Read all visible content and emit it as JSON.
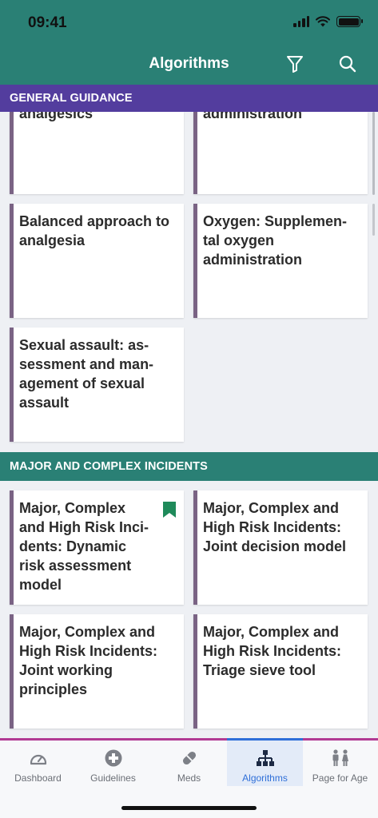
{
  "status_bar": {
    "time": "09:41"
  },
  "header": {
    "title": "Algorithms",
    "filter_icon": "filter-icon",
    "search_icon": "search-icon"
  },
  "sections": [
    {
      "title": "GENERAL GUIDANCE",
      "cards": [
        {
          "label": "analgesics",
          "truncated": true
        },
        {
          "label": "administration",
          "truncated": true
        },
        {
          "label": "Balanced approach to analgesia"
        },
        {
          "label": "Oxygen: Supplemen-tal oxygen administration"
        },
        {
          "label": "Sexual assault: as-sessment and man-agement of sexual assault"
        }
      ]
    },
    {
      "title": "MAJOR AND COMPLEX INCIDENTS",
      "cards": [
        {
          "label": "Major, Complex and High Risk Inci-dents: Dynamic risk assessment model",
          "bookmarked": true
        },
        {
          "label": "Major, Complex and High Risk Incidents: Joint decision model"
        },
        {
          "label": "Major, Complex and High Risk Incidents: Joint working principles"
        },
        {
          "label": "Major, Complex and High Risk Incidents: Triage sieve tool"
        }
      ]
    }
  ],
  "bottom_nav": [
    {
      "label": "Dashboard",
      "icon": "gauge-icon",
      "active": false
    },
    {
      "label": "Guidelines",
      "icon": "medical-cross-icon",
      "active": false
    },
    {
      "label": "Meds",
      "icon": "pill-icon",
      "active": false
    },
    {
      "label": "Algorithms",
      "icon": "flowchart-icon",
      "active": true
    },
    {
      "label": "Page for Age",
      "icon": "people-icon",
      "active": false
    }
  ],
  "colors": {
    "header_bg": "#2a8075",
    "general_section_bg": "#533d9e",
    "major_section_bg": "#2a8075",
    "card_accent": "#7a6384",
    "bookmark": "#1f8a5a",
    "active_nav": "#2f6fd8",
    "nav_top_border": "#b13a93"
  }
}
